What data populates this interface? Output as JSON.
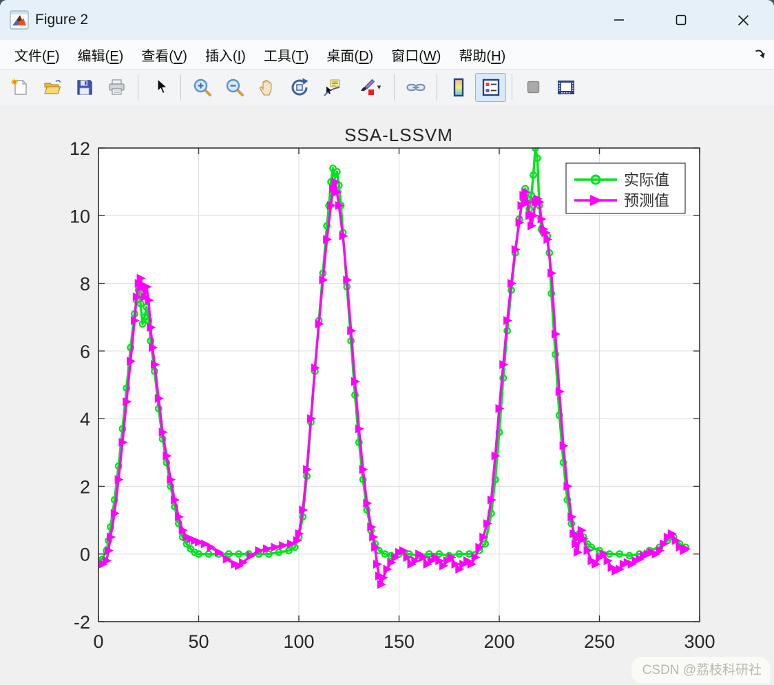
{
  "window": {
    "title": "Figure 2"
  },
  "menu": {
    "items": [
      {
        "id": "file",
        "label": "文件(F)"
      },
      {
        "id": "edit",
        "label": "编辑(E)"
      },
      {
        "id": "view",
        "label": "查看(V)"
      },
      {
        "id": "insert",
        "label": "插入(I)"
      },
      {
        "id": "tools",
        "label": "工具(T)"
      },
      {
        "id": "desktop",
        "label": "桌面(D)"
      },
      {
        "id": "window",
        "label": "窗口(W)"
      },
      {
        "id": "help",
        "label": "帮助(H)"
      }
    ]
  },
  "toolbar": {
    "buttons": [
      {
        "name": "new-figure",
        "icon": "new-figure"
      },
      {
        "name": "open-file",
        "icon": "open-file"
      },
      {
        "name": "save-figure",
        "icon": "save-figure"
      },
      {
        "name": "print-figure",
        "icon": "print-figure"
      },
      {
        "type": "separator"
      },
      {
        "name": "edit-plot",
        "icon": "arrow-cursor"
      },
      {
        "type": "separator"
      },
      {
        "name": "zoom-in",
        "icon": "zoom-in"
      },
      {
        "name": "zoom-out",
        "icon": "zoom-out"
      },
      {
        "name": "pan",
        "icon": "pan-hand"
      },
      {
        "name": "rotate-3d",
        "icon": "rotate-3d"
      },
      {
        "name": "data-cursor",
        "icon": "data-cursor"
      },
      {
        "name": "brush-data",
        "icon": "brush",
        "dropdown": true
      },
      {
        "type": "separator"
      },
      {
        "name": "link-plot",
        "icon": "link-chain"
      },
      {
        "type": "separator"
      },
      {
        "name": "insert-colorbar",
        "icon": "colorbar"
      },
      {
        "name": "insert-legend",
        "icon": "legend",
        "active": true
      },
      {
        "type": "separator"
      },
      {
        "name": "plot-tools-off",
        "icon": "gray-square"
      },
      {
        "name": "plot-tools-dock",
        "icon": "dock-window"
      }
    ]
  },
  "chart_data": {
    "type": "line",
    "title": "SSA-LSSVM",
    "xlabel": "",
    "ylabel": "",
    "xlim": [
      0,
      300
    ],
    "ylim": [
      -2,
      12
    ],
    "xticks": [
      0,
      50,
      100,
      150,
      200,
      250,
      300
    ],
    "yticks": [
      -2,
      0,
      2,
      4,
      6,
      8,
      10,
      12
    ],
    "grid": true,
    "legend_position": "northeast",
    "series": [
      {
        "name": "实际值",
        "color": "#00e41c",
        "marker": "circle",
        "points": [
          [
            0,
            -0.2
          ],
          [
            2,
            -0.15
          ],
          [
            4,
            0.1
          ],
          [
            5,
            0.4
          ],
          [
            6,
            0.8
          ],
          [
            8,
            1.6
          ],
          [
            10,
            2.6
          ],
          [
            12,
            3.7
          ],
          [
            14,
            4.9
          ],
          [
            16,
            6.1
          ],
          [
            18,
            7.1
          ],
          [
            19,
            7.5
          ],
          [
            20,
            7.8
          ],
          [
            21,
            7.4
          ],
          [
            22,
            6.8
          ],
          [
            23,
            7.0
          ],
          [
            24,
            7.3
          ],
          [
            25,
            6.9
          ],
          [
            26,
            6.3
          ],
          [
            28,
            5.4
          ],
          [
            30,
            4.3
          ],
          [
            32,
            3.4
          ],
          [
            34,
            2.7
          ],
          [
            36,
            2.0
          ],
          [
            38,
            1.4
          ],
          [
            40,
            0.9
          ],
          [
            42,
            0.5
          ],
          [
            44,
            0.3
          ],
          [
            46,
            0.15
          ],
          [
            48,
            0.05
          ],
          [
            50,
            0
          ],
          [
            55,
            0
          ],
          [
            60,
            0
          ],
          [
            65,
            0
          ],
          [
            70,
            0
          ],
          [
            75,
            0
          ],
          [
            80,
            0
          ],
          [
            85,
            0
          ],
          [
            90,
            0.05
          ],
          [
            95,
            0.1
          ],
          [
            98,
            0.2
          ],
          [
            100,
            0.5
          ],
          [
            102,
            1.1
          ],
          [
            104,
            2.3
          ],
          [
            106,
            3.9
          ],
          [
            108,
            5.4
          ],
          [
            110,
            6.9
          ],
          [
            112,
            8.3
          ],
          [
            114,
            9.7
          ],
          [
            115,
            10.3
          ],
          [
            116,
            11.0
          ],
          [
            117,
            11.4
          ],
          [
            118,
            11.1
          ],
          [
            119,
            11.3
          ],
          [
            120,
            10.9
          ],
          [
            121,
            10.3
          ],
          [
            122,
            9.5
          ],
          [
            124,
            7.9
          ],
          [
            126,
            6.3
          ],
          [
            128,
            4.7
          ],
          [
            130,
            3.3
          ],
          [
            132,
            2.2
          ],
          [
            134,
            1.3
          ],
          [
            136,
            0.7
          ],
          [
            138,
            0.3
          ],
          [
            140,
            0.1
          ],
          [
            143,
            0
          ],
          [
            146,
            -0.05
          ],
          [
            150,
            0
          ],
          [
            155,
            0
          ],
          [
            160,
            -0.05
          ],
          [
            165,
            0
          ],
          [
            170,
            0
          ],
          [
            175,
            -0.05
          ],
          [
            180,
            0
          ],
          [
            185,
            0
          ],
          [
            190,
            0.1
          ],
          [
            193,
            0.3
          ],
          [
            196,
            1.2
          ],
          [
            198,
            2.2
          ],
          [
            200,
            3.6
          ],
          [
            202,
            5.2
          ],
          [
            204,
            6.6
          ],
          [
            206,
            7.8
          ],
          [
            208,
            8.9
          ],
          [
            210,
            9.9
          ],
          [
            212,
            10.5
          ],
          [
            213,
            10.8
          ],
          [
            214,
            10.5
          ],
          [
            215,
            10.2
          ],
          [
            216,
            10.6
          ],
          [
            217,
            11.2
          ],
          [
            218,
            12.0
          ],
          [
            219,
            11.7
          ],
          [
            220,
            10.3
          ],
          [
            221,
            9.6
          ],
          [
            222,
            9.5
          ],
          [
            224,
            9.4
          ],
          [
            225,
            8.9
          ],
          [
            226,
            7.7
          ],
          [
            228,
            5.9
          ],
          [
            230,
            4.1
          ],
          [
            232,
            2.7
          ],
          [
            234,
            1.6
          ],
          [
            236,
            0.9
          ],
          [
            238,
            0.5
          ],
          [
            240,
            0.6
          ],
          [
            242,
            0.5
          ],
          [
            244,
            0.3
          ],
          [
            246,
            0.2
          ],
          [
            250,
            0.1
          ],
          [
            255,
            0
          ],
          [
            260,
            0
          ],
          [
            265,
            -0.05
          ],
          [
            270,
            0
          ],
          [
            275,
            0.1
          ],
          [
            280,
            0.2
          ],
          [
            284,
            0.4
          ],
          [
            287,
            0.5
          ],
          [
            290,
            0.3
          ],
          [
            293,
            0.2
          ]
        ]
      },
      {
        "name": "预测值",
        "color": "#ff00ff",
        "marker": "triangle-right",
        "points": [
          [
            0,
            -0.3
          ],
          [
            2,
            -0.3
          ],
          [
            4,
            -0.2
          ],
          [
            5,
            0.1
          ],
          [
            6,
            0.5
          ],
          [
            8,
            1.2
          ],
          [
            10,
            2.2
          ],
          [
            12,
            3.3
          ],
          [
            14,
            4.5
          ],
          [
            16,
            5.7
          ],
          [
            18,
            6.9
          ],
          [
            19,
            7.6
          ],
          [
            20,
            8.0
          ],
          [
            21,
            8.15
          ],
          [
            22,
            7.9
          ],
          [
            23,
            7.6
          ],
          [
            24,
            7.9
          ],
          [
            25,
            7.5
          ],
          [
            26,
            6.7
          ],
          [
            27,
            6.1
          ],
          [
            28,
            5.6
          ],
          [
            30,
            4.6
          ],
          [
            32,
            3.6
          ],
          [
            34,
            2.9
          ],
          [
            36,
            2.2
          ],
          [
            38,
            1.6
          ],
          [
            40,
            1.1
          ],
          [
            42,
            0.7
          ],
          [
            44,
            0.5
          ],
          [
            46,
            0.45
          ],
          [
            48,
            0.4
          ],
          [
            50,
            0.35
          ],
          [
            53,
            0.3
          ],
          [
            56,
            0.2
          ],
          [
            60,
            0.05
          ],
          [
            64,
            -0.15
          ],
          [
            68,
            -0.3
          ],
          [
            70,
            -0.35
          ],
          [
            72,
            -0.25
          ],
          [
            76,
            -0.05
          ],
          [
            80,
            0.1
          ],
          [
            84,
            0.15
          ],
          [
            88,
            0.2
          ],
          [
            92,
            0.25
          ],
          [
            96,
            0.3
          ],
          [
            99,
            0.4
          ],
          [
            100,
            0.6
          ],
          [
            102,
            1.3
          ],
          [
            104,
            2.5
          ],
          [
            106,
            4.0
          ],
          [
            108,
            5.5
          ],
          [
            110,
            6.8
          ],
          [
            112,
            8.1
          ],
          [
            114,
            9.3
          ],
          [
            116,
            10.3
          ],
          [
            117,
            10.8
          ],
          [
            118,
            11.0
          ],
          [
            119,
            10.7
          ],
          [
            120,
            10.3
          ],
          [
            122,
            9.4
          ],
          [
            124,
            8.1
          ],
          [
            126,
            6.6
          ],
          [
            128,
            5.1
          ],
          [
            130,
            3.7
          ],
          [
            132,
            2.5
          ],
          [
            134,
            1.5
          ],
          [
            136,
            0.8
          ],
          [
            137,
            0.5
          ],
          [
            138,
            0.2
          ],
          [
            139,
            -0.3
          ],
          [
            140,
            -0.65
          ],
          [
            141,
            -0.9
          ],
          [
            142,
            -0.7
          ],
          [
            144,
            -0.45
          ],
          [
            146,
            -0.25
          ],
          [
            148,
            -0.1
          ],
          [
            150,
            0.05
          ],
          [
            152,
            0.1
          ],
          [
            154,
            -0.1
          ],
          [
            156,
            -0.3
          ],
          [
            158,
            -0.2
          ],
          [
            160,
            0
          ],
          [
            162,
            -0.1
          ],
          [
            164,
            -0.3
          ],
          [
            166,
            -0.2
          ],
          [
            168,
            -0.1
          ],
          [
            170,
            -0.2
          ],
          [
            172,
            -0.35
          ],
          [
            174,
            -0.2
          ],
          [
            176,
            -0.1
          ],
          [
            178,
            -0.3
          ],
          [
            180,
            -0.45
          ],
          [
            182,
            -0.3
          ],
          [
            184,
            -0.2
          ],
          [
            186,
            -0.3
          ],
          [
            188,
            -0.1
          ],
          [
            190,
            0.2
          ],
          [
            192,
            0.5
          ],
          [
            194,
            0.9
          ],
          [
            196,
            1.6
          ],
          [
            198,
            2.9
          ],
          [
            200,
            4.3
          ],
          [
            202,
            5.6
          ],
          [
            204,
            6.9
          ],
          [
            206,
            8.0
          ],
          [
            208,
            9.0
          ],
          [
            210,
            9.8
          ],
          [
            211,
            10.3
          ],
          [
            212,
            10.6
          ],
          [
            213,
            10.7
          ],
          [
            214,
            10.4
          ],
          [
            215,
            10.0
          ],
          [
            216,
            9.7
          ],
          [
            217,
            10.0
          ],
          [
            218,
            10.4
          ],
          [
            219,
            10.5
          ],
          [
            220,
            10.4
          ],
          [
            221,
            9.9
          ],
          [
            222,
            9.6
          ],
          [
            223,
            9.5
          ],
          [
            224,
            9.3
          ],
          [
            226,
            8.3
          ],
          [
            228,
            6.5
          ],
          [
            230,
            4.8
          ],
          [
            232,
            3.2
          ],
          [
            234,
            2.0
          ],
          [
            236,
            1.1
          ],
          [
            237,
            0.6
          ],
          [
            238,
            0.3
          ],
          [
            239,
            0.05
          ],
          [
            240,
            0.5
          ],
          [
            241,
            0.7
          ],
          [
            242,
            0.45
          ],
          [
            244,
            0.1
          ],
          [
            246,
            -0.2
          ],
          [
            248,
            -0.3
          ],
          [
            250,
            -0.1
          ],
          [
            252,
            0
          ],
          [
            254,
            -0.2
          ],
          [
            256,
            -0.4
          ],
          [
            258,
            -0.5
          ],
          [
            260,
            -0.45
          ],
          [
            262,
            -0.3
          ],
          [
            264,
            -0.25
          ],
          [
            266,
            -0.3
          ],
          [
            268,
            -0.2
          ],
          [
            270,
            -0.15
          ],
          [
            272,
            -0.05
          ],
          [
            274,
            0
          ],
          [
            276,
            0.05
          ],
          [
            278,
            0
          ],
          [
            280,
            0.1
          ],
          [
            282,
            0.3
          ],
          [
            284,
            0.5
          ],
          [
            286,
            0.6
          ],
          [
            288,
            0.4
          ],
          [
            290,
            0.2
          ],
          [
            292,
            0.1
          ],
          [
            293,
            0.15
          ]
        ]
      }
    ]
  },
  "watermark": {
    "text": "CSDN @荔枝科研社"
  }
}
